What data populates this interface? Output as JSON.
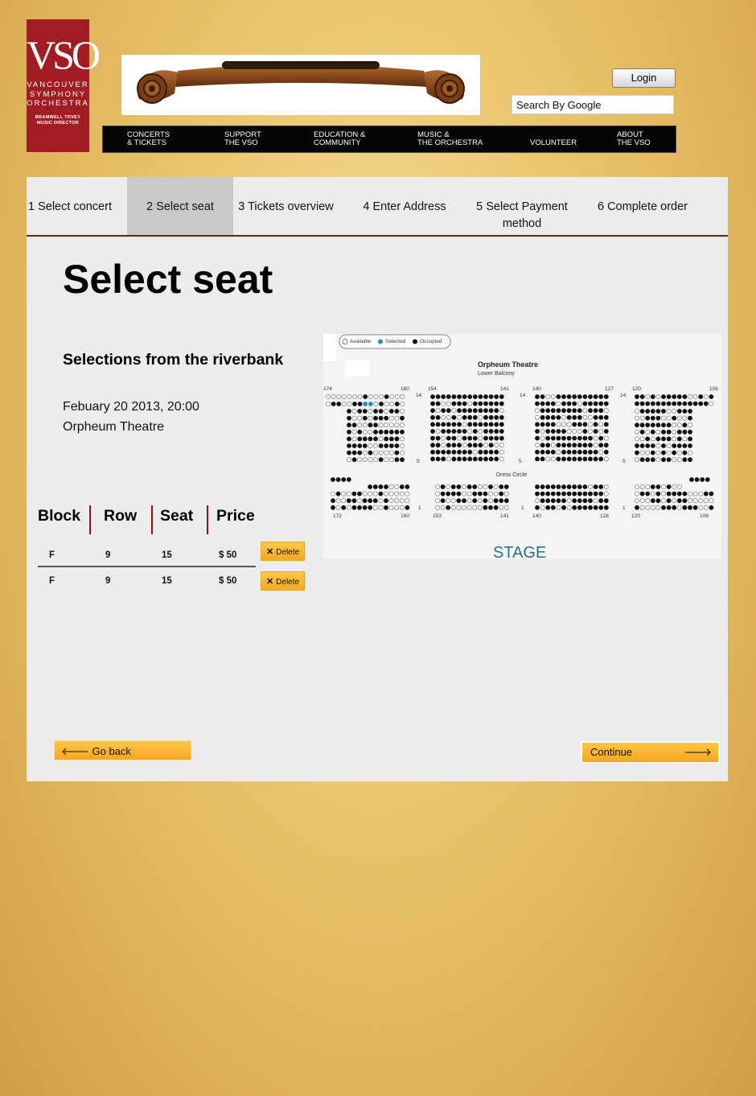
{
  "brand": {
    "logo_text": "VSO",
    "logo_sub": "VANCOUVER\nSYMPHONY\nORCHESTRA",
    "logo_tagline": "BRAMWELL TOVEY\nMUSIC DIRECTOR",
    "color": "#a11d23"
  },
  "header": {
    "login_label": "Login",
    "search_placeholder": "Search By Google"
  },
  "nav": [
    {
      "label": "CONCERTS\n& TICKETS"
    },
    {
      "label": "SUPPORT\nTHE VSO"
    },
    {
      "label": "EDUCATION &\nCOMMUNITY"
    },
    {
      "label": "MUSIC &\nTHE ORCHESTRA"
    },
    {
      "label": "VOLUNTEER"
    },
    {
      "label": "ABOUT\nTHE VSO"
    }
  ],
  "steps": [
    {
      "label": "1 Select concert"
    },
    {
      "label": "2 Select seat",
      "active": true
    },
    {
      "label": "3 Tickets overview"
    },
    {
      "label": "4 Enter Address"
    },
    {
      "label": "5 Select Payment method"
    },
    {
      "label": "6 Complete order"
    }
  ],
  "main": {
    "title": "Select seat",
    "concert_title": "Selections from the riverbank",
    "date": "Febuary 20 2013, 20:00",
    "venue": "Orpheum Theatre"
  },
  "tickets": {
    "headers": [
      "Block",
      "Row",
      "Seat",
      "Price"
    ],
    "rows": [
      {
        "block": "F",
        "row": "9",
        "seat": "15",
        "price": "$ 50",
        "action": "Delete"
      },
      {
        "block": "F",
        "row": "9",
        "seat": "15",
        "price": "$ 50",
        "action": "Delete"
      }
    ]
  },
  "seatmap": {
    "legend": {
      "available": "Available",
      "selected": "Selected",
      "occupied": "Occupied"
    },
    "theatre": "Orpheum Theatre",
    "section": "Lower Balcony",
    "dress_circle": "Dress Circle",
    "stage": "STAGE",
    "top_numbers": [
      "174",
      "160",
      "14",
      "154",
      "141",
      "14",
      "140",
      "127",
      "14",
      "120",
      "106"
    ],
    "mid_numbers": [
      "5",
      "5",
      "5"
    ],
    "bottom_numbers": [
      "172",
      "160",
      "1",
      "153",
      "141",
      "1",
      "140",
      "128",
      "1",
      "120",
      "108"
    ],
    "colors": {
      "available": "#ffffff",
      "selected": "#2a8ea6",
      "occupied": "#111111",
      "stage": "#2e7083"
    }
  },
  "footer": {
    "back_label": "Go back",
    "continue_label": "Continue"
  }
}
